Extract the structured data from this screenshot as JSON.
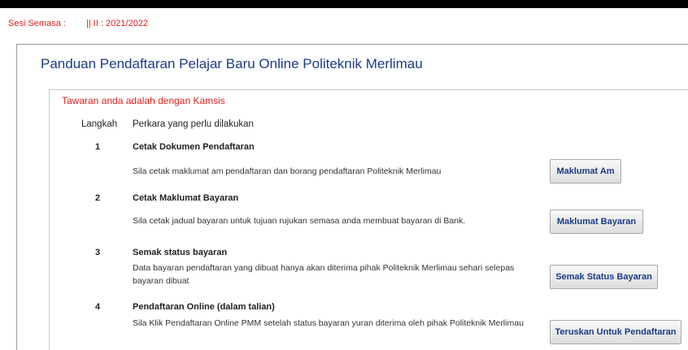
{
  "session": {
    "label": "Sesi Semasa :",
    "value": "|| II : 2021/2022"
  },
  "page": {
    "title": "Panduan Pendaftaran Pelajar Baru Online Politeknik Merlimau"
  },
  "offer": {
    "text": "Tawaran anda adalah dengan Kamsis"
  },
  "table": {
    "headers": [
      "Langkah",
      "Perkara yang perlu dilakukan"
    ],
    "steps": [
      {
        "number": "1",
        "title": "Cetak Dokumen Pendaftaran",
        "description": "Sila cetak maklumat am pendaftaran dan borang pendaftaran Politeknik Merlimau",
        "button": "Maklumat Am"
      },
      {
        "number": "2",
        "title": "Cetak Maklumat Bayaran",
        "description": "Sila cetak jadual bayaran untuk tujuan rujukan semasa anda membuat bayaran di Bank.",
        "button": "Maklumat Bayaran"
      },
      {
        "number": "3",
        "title": "Semak status bayaran",
        "description": "Data bayaran pendaftaran yang dibuat hanya akan diterima pihak Politeknik Merlimau sehari selepas bayaran dibuat",
        "button": "Semak Status Bayaran"
      },
      {
        "number": "4",
        "title": "Pendaftaran Online (dalam talian)",
        "description": "Sila Klik Pendaftaran Online PMM setelah status bayaran yuran diterima oleh pihak Politeknik Merlimau",
        "button": "Teruskan Untuk Pendaftaran"
      }
    ]
  },
  "colors": {
    "accent_red": "#e02020",
    "title_blue": "#1b3a87",
    "border_black": "#000000"
  }
}
